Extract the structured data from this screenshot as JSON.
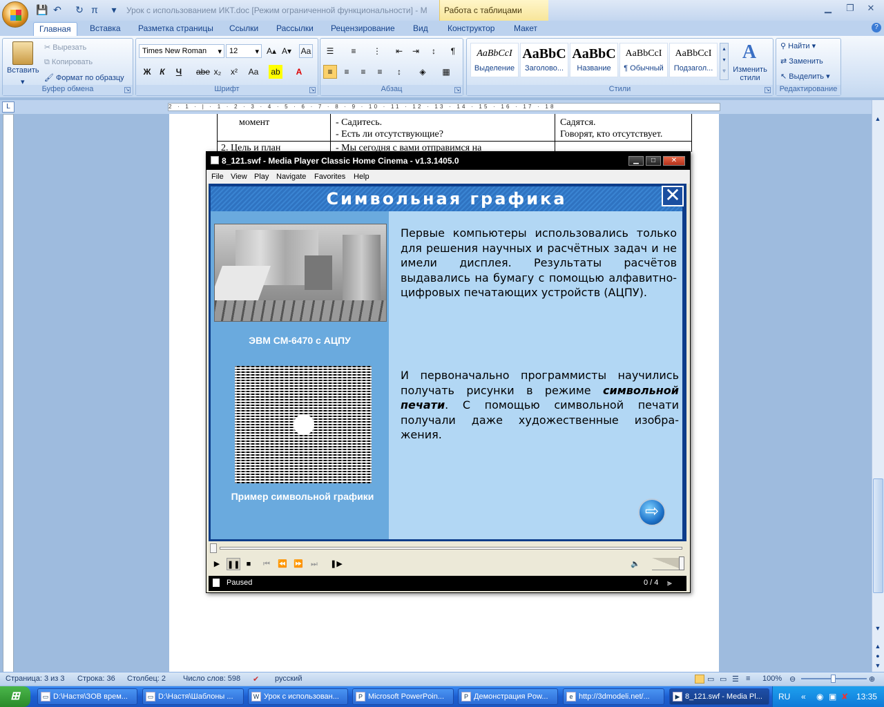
{
  "word": {
    "doc_title": "Урок с использованием ИКТ.doc [Режим ограниченной функциональности] - M",
    "context_tab": "Работа с таблицами",
    "tabs": [
      "Главная",
      "Вставка",
      "Разметка страницы",
      "Ссылки",
      "Рассылки",
      "Рецензирование",
      "Вид",
      "Конструктор",
      "Макет"
    ],
    "clipboard": {
      "paste": "Вставить",
      "cut": "Вырезать",
      "copy": "Копировать",
      "format_painter": "Формат по образцу",
      "label": "Буфер обмена"
    },
    "font": {
      "name": "Times New Roman",
      "size": "12",
      "label": "Шрифт",
      "bold": "Ж",
      "italic": "К",
      "underline": "Ч",
      "strike": "abe",
      "sub": "x₂",
      "sup": "x²",
      "case": "Aa"
    },
    "paragraph": {
      "label": "Абзац"
    },
    "styles": {
      "label": "Стили",
      "change": "Изменить стили",
      "items": [
        {
          "preview": "AaBbCcI",
          "name": "Выделение"
        },
        {
          "preview": "AaBbC",
          "name": "Заголово..."
        },
        {
          "preview": "AaBbC",
          "name": "Название"
        },
        {
          "preview": "AaBbCcI",
          "name": "¶ Обычный"
        },
        {
          "preview": "AaBbCcI",
          "name": "Подзагол..."
        }
      ]
    },
    "editing": {
      "label": "Редактирование",
      "find": "Найти",
      "replace": "Заменить",
      "select": "Выделить"
    },
    "ruler_text": "2 · 1 · | · 1 · 2 · 3 · 4 · 5 · 6 · 7 · 8 · 9 · 10 · 11 · 12 · 13 · 14 · 15 · 16 · 17 · 18",
    "table": {
      "r1c1": "момент",
      "r1c2a": "- Садитесь.",
      "r1c2b": "- Есть ли отсутствующие?",
      "r1c3a": "Садятся.",
      "r1c3b": "Говорят, кто отсутствует.",
      "r2c1": "2.   Цель и план",
      "r2c2": "- Мы сегодня с вами отправимся на"
    },
    "status": {
      "page": "Страница: 3 из 3",
      "line": "Строка: 36",
      "col": "Столбец: 2",
      "words": "Число слов: 598",
      "lang": "русский",
      "zoom": "100%"
    }
  },
  "player": {
    "title": "8_121.swf - Media Player Classic Home Cinema - v1.3.1405.0",
    "menu": [
      "File",
      "View",
      "Play",
      "Navigate",
      "Favorites",
      "Help"
    ],
    "slide": {
      "title": "Символьная графика",
      "cap1": "ЭВМ СМ-6470 с АЦПУ",
      "cap2": "Пример символьной графики",
      "para1": "Первые компьютеры использовались только для решения научных и расчётных задач и не имели дисплея. Результаты расчётов выдавались на бумагу с помощью алфавитно-цифровых печатающих устройств (АЦПУ).",
      "para2_a": "И первоначально программисты научились получать рисунки в режиме ",
      "para2_b": "символьной печати",
      "para2_c": ". С помощью символьной печати получали даже художественные изобра-жения."
    },
    "status": "Paused",
    "frame": "0 / 4"
  },
  "taskbar": {
    "start": "пуск",
    "tasks": [
      "D:\\Настя\\ЗОВ врем...",
      "D:\\Настя\\Шаблоны ...",
      "Урок с использован...",
      "Microsoft PowerPoin...",
      "Демонстрация Pow...",
      "http://3dmodeli.net/...",
      "8_121.swf - Media Pl..."
    ],
    "lang": "RU",
    "time": "13:35"
  }
}
